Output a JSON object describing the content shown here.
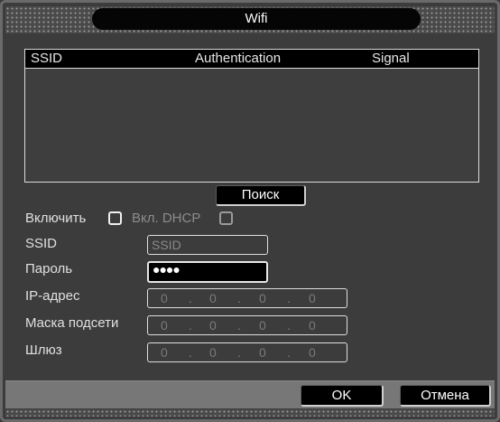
{
  "window": {
    "title": "Wifi"
  },
  "list": {
    "columns": [
      "SSID",
      "Authentication",
      "Signal"
    ],
    "rows": []
  },
  "search_button": "Поиск",
  "form": {
    "enable_label": "Включить",
    "dhcp_label": "Вкл. DHCP",
    "enable_checked": false,
    "dhcp_checked": false,
    "ssid_label": "SSID",
    "ssid_value": "SSID",
    "password_label": "Пароль",
    "password_value": "●●●●",
    "ip_label": "IP-адрес",
    "ip_value": [
      "0",
      "0",
      "0",
      "0"
    ],
    "mask_label": "Маска подсети",
    "mask_value": [
      "0",
      "0",
      "0",
      "0"
    ],
    "gateway_label": "Шлюз",
    "gateway_value": [
      "0",
      "0",
      "0",
      "0"
    ],
    "ip_separator": "."
  },
  "buttons": {
    "ok": "OK",
    "cancel": "Отмена"
  },
  "colors": {
    "title_bg": "#050505",
    "panel_bg": "#3c3c3c",
    "bottom_bar": "#777777"
  }
}
